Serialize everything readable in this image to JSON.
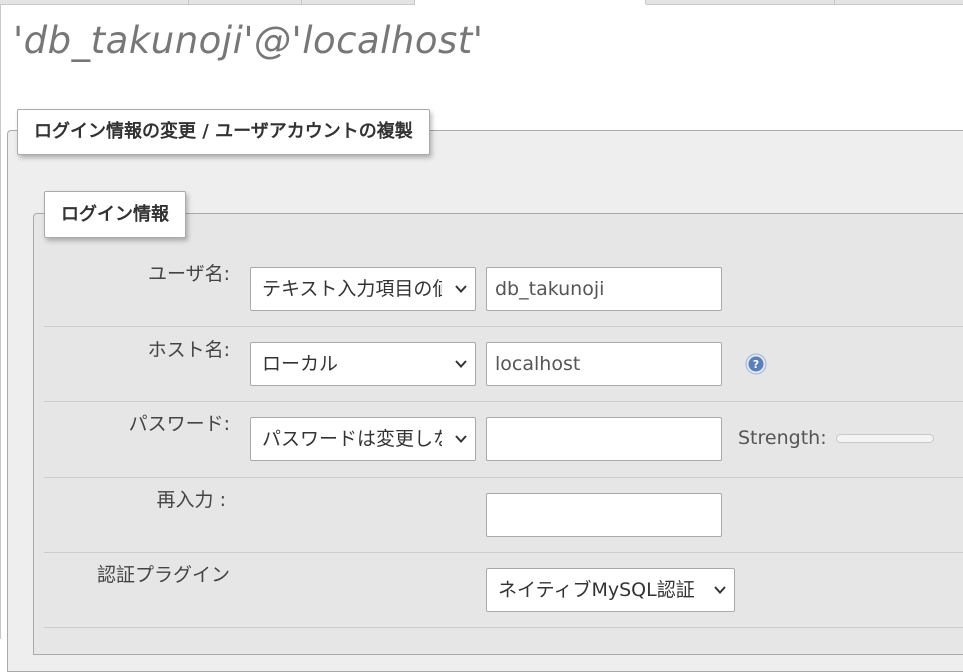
{
  "header": {
    "title": "'db_takunoji'@'localhost'"
  },
  "sections": {
    "outer_legend": "ログイン情報の変更 / ユーザアカウントの複製",
    "inner_legend": "ログイン情報"
  },
  "form": {
    "username": {
      "label": "ユーザ名:",
      "select_value": "テキスト入力項目の値を使用する",
      "input_value": "db_takunoji"
    },
    "host": {
      "label": "ホスト名:",
      "select_value": "ローカル",
      "input_value": "localhost"
    },
    "password": {
      "label": "パスワード:",
      "select_value": "パスワードは変更しない",
      "input_value": "",
      "strength_label": "Strength:",
      "strength_level": 0
    },
    "reenter": {
      "label": "再入力 :",
      "input_value": ""
    },
    "auth_plugin": {
      "label": "認証プラグイン",
      "select_value": "ネイティブMySQL認証"
    }
  },
  "icons": {
    "chevron": "chevron-down-icon",
    "help": "help-icon"
  },
  "colors": {
    "help_icon": "#5b7fb9"
  }
}
